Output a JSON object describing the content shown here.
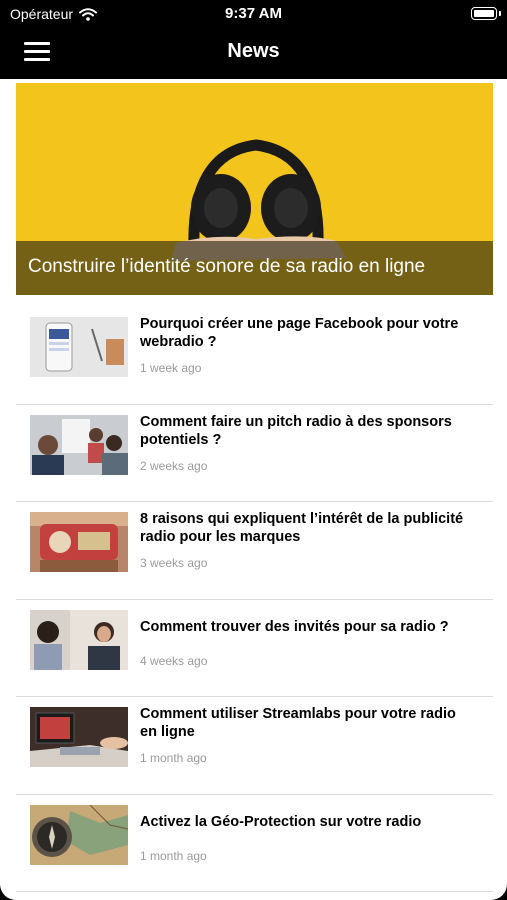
{
  "status": {
    "carrier": "Opérateur",
    "time": "9:37 AM"
  },
  "nav": {
    "title": "News"
  },
  "hero": {
    "title": "Construire l’identité sonore de sa radio en ligne"
  },
  "articles": [
    {
      "title": "Pourquoi créer une page Facebook pour votre webradio ?",
      "meta": "1 week ago"
    },
    {
      "title": "Comment faire un pitch radio à des sponsors potentiels ?",
      "meta": "2 weeks ago"
    },
    {
      "title": "8 raisons qui expliquent l’intérêt de la publicité radio pour les marques",
      "meta": "3 weeks ago"
    },
    {
      "title": "Comment trouver des invités pour sa radio ?",
      "meta": "4 weeks ago"
    },
    {
      "title": "Comment utiliser Streamlabs pour votre radio en ligne",
      "meta": "1 month ago"
    },
    {
      "title": "Activez la Géo-Protection sur votre radio",
      "meta": "1 month ago"
    }
  ],
  "colors": {
    "accent_yellow": "#f2c41c",
    "nav_background": "#000000",
    "meta_gray": "#9a9a9a"
  }
}
